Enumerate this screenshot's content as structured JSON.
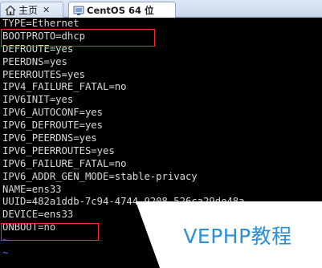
{
  "tabs": [
    {
      "label": "主页",
      "icon": "home-icon",
      "active": false
    },
    {
      "label": "CentOS 64 位",
      "icon": "vm-icon",
      "active": true
    }
  ],
  "terminal": {
    "lines": [
      "TYPE=Ethernet",
      "BOOTPROTO=dhcp",
      "DEFROUTE=yes",
      "PEERDNS=yes",
      "PEERROUTES=yes",
      "IPV4_FAILURE_FATAL=no",
      "IPV6INIT=yes",
      "IPV6_AUTOCONF=yes",
      "IPV6_DEFROUTE=yes",
      "IPV6_PEERDNS=yes",
      "IPV6_PEERROUTES=yes",
      "IPV6_FAILURE_FATAL=no",
      "IPV6_ADDR_GEN_MODE=stable-privacy",
      "NAME=ens33",
      "UUID=482a1ddb-7c94-4744-9208-526ca29de48a",
      "DEVICE=ens33",
      "ONBOOT=no",
      "~",
      "~"
    ],
    "highlighted": [
      "BOOTPROTO=dhcp",
      "ONBOOT=no"
    ]
  },
  "watermark": "VEPHP教程",
  "colors": {
    "terminal_bg": "#000000",
    "terminal_text": "#d8d8d8",
    "tilde": "#4a6cff",
    "highlight_box": "#ff2a2a",
    "watermark_text": "#2a8fd6"
  }
}
